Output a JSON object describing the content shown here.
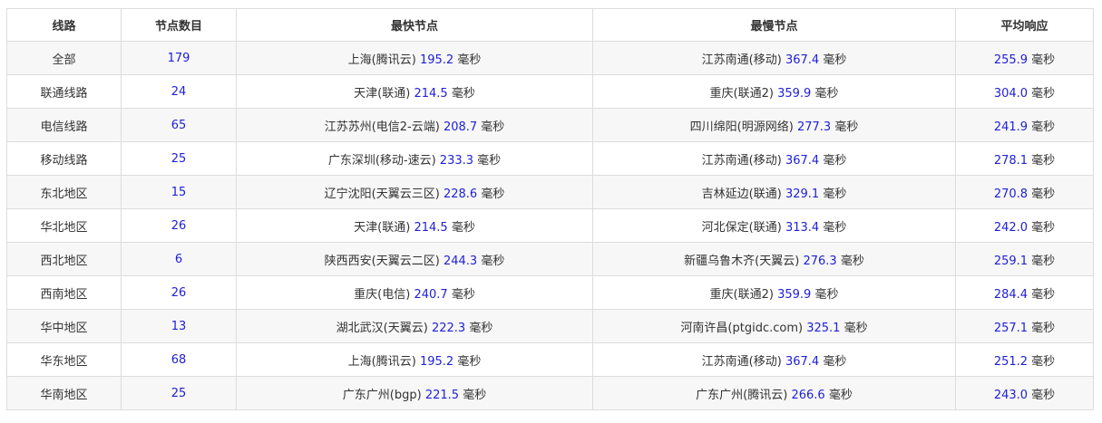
{
  "headers": [
    "线路",
    "节点数目",
    "最快节点",
    "最慢节点",
    "平均响应"
  ],
  "unit": "毫秒",
  "rows": [
    {
      "route": "全部",
      "count": "179",
      "fast_node": "上海(腾讯云)",
      "fast_ms": "195.2",
      "slow_node": "江苏南通(移动)",
      "slow_ms": "367.4",
      "avg_ms": "255.9"
    },
    {
      "route": "联通线路",
      "count": "24",
      "fast_node": "天津(联通)",
      "fast_ms": "214.5",
      "slow_node": "重庆(联通2)",
      "slow_ms": "359.9",
      "avg_ms": "304.0"
    },
    {
      "route": "电信线路",
      "count": "65",
      "fast_node": "江苏苏州(电信2-云端)",
      "fast_ms": "208.7",
      "slow_node": "四川绵阳(明源网络)",
      "slow_ms": "277.3",
      "avg_ms": "241.9"
    },
    {
      "route": "移动线路",
      "count": "25",
      "fast_node": "广东深圳(移动-速云)",
      "fast_ms": "233.3",
      "slow_node": "江苏南通(移动)",
      "slow_ms": "367.4",
      "avg_ms": "278.1"
    },
    {
      "route": "东北地区",
      "count": "15",
      "fast_node": "辽宁沈阳(天翼云三区)",
      "fast_ms": "228.6",
      "slow_node": "吉林延边(联通)",
      "slow_ms": "329.1",
      "avg_ms": "270.8"
    },
    {
      "route": "华北地区",
      "count": "26",
      "fast_node": "天津(联通)",
      "fast_ms": "214.5",
      "slow_node": "河北保定(联通)",
      "slow_ms": "313.4",
      "avg_ms": "242.0"
    },
    {
      "route": "西北地区",
      "count": "6",
      "fast_node": "陕西西安(天翼云二区)",
      "fast_ms": "244.3",
      "slow_node": "新疆乌鲁木齐(天翼云)",
      "slow_ms": "276.3",
      "avg_ms": "259.1"
    },
    {
      "route": "西南地区",
      "count": "26",
      "fast_node": "重庆(电信)",
      "fast_ms": "240.7",
      "slow_node": "重庆(联通2)",
      "slow_ms": "359.9",
      "avg_ms": "284.4"
    },
    {
      "route": "华中地区",
      "count": "13",
      "fast_node": "湖北武汉(天翼云)",
      "fast_ms": "222.3",
      "slow_node": "河南许昌(ptgidc.com)",
      "slow_ms": "325.1",
      "avg_ms": "257.1"
    },
    {
      "route": "华东地区",
      "count": "68",
      "fast_node": "上海(腾讯云)",
      "fast_ms": "195.2",
      "slow_node": "江苏南通(移动)",
      "slow_ms": "367.4",
      "avg_ms": "251.2"
    },
    {
      "route": "华南地区",
      "count": "25",
      "fast_node": "广东广州(bgp)",
      "fast_ms": "221.5",
      "slow_node": "广东广州(腾讯云)",
      "slow_ms": "266.6",
      "avg_ms": "243.0"
    }
  ],
  "colors": {
    "number": "#2020d8",
    "text": "#333333",
    "border": "#dddddd",
    "stripe": "#f7f7f7"
  }
}
